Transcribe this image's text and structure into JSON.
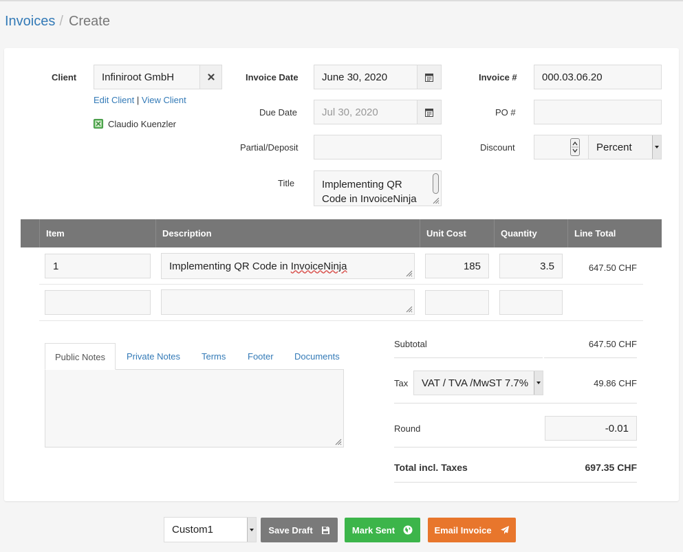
{
  "breadcrumb": {
    "parent": "Invoices",
    "separator": "/",
    "current": "Create"
  },
  "client": {
    "label": "Client",
    "value": "Infiniroot GmbH",
    "edit_link": "Edit Client",
    "divider": "|",
    "view_link": "View Client",
    "contact": "Claudio Kuenzler"
  },
  "dates": {
    "invoice_date_label": "Invoice Date",
    "invoice_date": "June 30, 2020",
    "due_date_label": "Due Date",
    "due_date_placeholder": "Jul 30, 2020",
    "partial_label": "Partial/Deposit",
    "partial_value": "",
    "title_label": "Title",
    "title_value": "Implementing QR Code in InvoiceNinja"
  },
  "meta": {
    "invoice_no_label": "Invoice #",
    "invoice_no": "000.03.06.20",
    "po_label": "PO #",
    "po_value": "",
    "discount_label": "Discount",
    "discount_value": "",
    "discount_type": "Percent"
  },
  "table": {
    "headers": {
      "item": "Item",
      "description": "Description",
      "unit_cost": "Unit Cost",
      "quantity": "Quantity",
      "line_total": "Line Total"
    },
    "rows": [
      {
        "item": "1",
        "description_pre": "Implementing QR Code in ",
        "description_misspelled": "InvoiceNinja",
        "unit_cost": "185",
        "quantity": "3.5",
        "line_total": "647.50 CHF"
      },
      {
        "item": "",
        "description": "",
        "unit_cost": "",
        "quantity": "",
        "line_total": ""
      }
    ]
  },
  "tabs": [
    "Public Notes",
    "Private Notes",
    "Terms",
    "Footer",
    "Documents"
  ],
  "totals": {
    "subtotal_label": "Subtotal",
    "subtotal": "647.50 CHF",
    "tax_label": "Tax",
    "tax_option": "VAT / TVA /MwST 7.7%",
    "tax_amount": "49.86 CHF",
    "round_label": "Round",
    "round_value": "-0.01",
    "total_label": "Total incl. Taxes",
    "total": "697.35 CHF"
  },
  "actions": {
    "design_option": "Custom1",
    "save_draft": "Save Draft",
    "mark_sent": "Mark Sent",
    "email_invoice": "Email Invoice"
  },
  "colors": {
    "link": "#337ab7",
    "save_draft": "#7a7a7a",
    "mark_sent": "#3cb54a",
    "email_invoice": "#e8762c",
    "table_header": "#777777"
  }
}
